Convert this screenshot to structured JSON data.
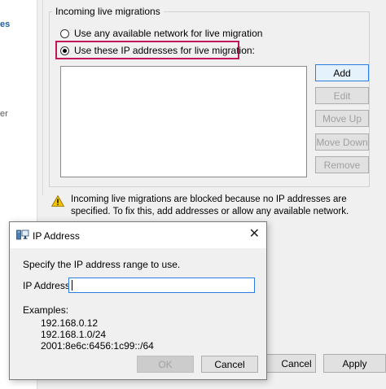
{
  "left_nav": {
    "item_active": "es",
    "item_other": "er"
  },
  "group": {
    "legend": "Incoming live migrations",
    "options": [
      {
        "label": "Use any available network for live migration",
        "checked": false
      },
      {
        "label": "Use these IP addresses for live migration:",
        "checked": true
      }
    ],
    "buttons": [
      {
        "label": "Add",
        "enabled": true
      },
      {
        "label": "Edit",
        "enabled": false
      },
      {
        "label": "Move Up",
        "enabled": false
      },
      {
        "label": "Move Down",
        "enabled": false
      },
      {
        "label": "Remove",
        "enabled": false
      }
    ]
  },
  "warning": {
    "icon": "warning-icon",
    "text": "Incoming live migrations are blocked because no IP addresses are specified. To fix this, add addresses or allow any available network."
  },
  "footer": {
    "cancel_label": "Cancel",
    "apply_label": "Apply"
  },
  "dialog": {
    "title": "IP Address",
    "icon": "network-computer-icon",
    "prompt": "Specify the IP address range to use.",
    "field_label": "IP Address",
    "field_value": "",
    "examples_label": "Examples:",
    "examples": [
      "192.168.0.12",
      "192.168.1.0/24",
      "2001:8e6c:6456:1c99::/64"
    ],
    "ok_label": "OK",
    "cancel_label": "Cancel",
    "close_glyph": "✕"
  },
  "colors": {
    "highlight": "#c2185b",
    "accent": "#2b7de1",
    "warning": "#f2c200"
  }
}
